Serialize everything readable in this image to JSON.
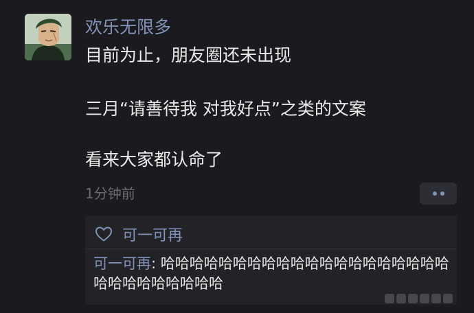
{
  "post": {
    "username": "欢乐无限多",
    "lines": [
      "目前为止，朋友圈还未出现",
      "三月“请善待我 对我好点”之类的文案",
      "看来大家都认命了"
    ],
    "time": "1分钟前",
    "avatar_icon": "anime-character-avatar",
    "more_icon": "more-dots-icon"
  },
  "interactions": {
    "like_icon": "heart-outline-icon",
    "likers": "可一可再",
    "comments": [
      {
        "author": "可一可再",
        "separator": ": ",
        "text": "哈哈哈哈哈哈哈哈哈哈哈哈哈哈哈哈哈哈哈哈哈哈哈哈哈哈哈哈哈"
      }
    ]
  },
  "colors": {
    "background": "#1b1b1f",
    "name": "#8193b8",
    "text": "#ebebeb",
    "muted": "#6c6c70",
    "panel": "#232327"
  }
}
